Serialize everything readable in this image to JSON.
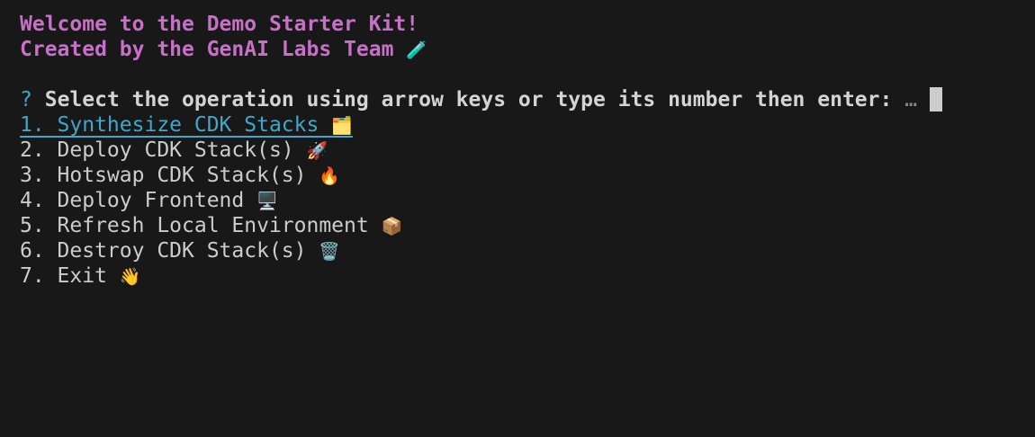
{
  "header": {
    "welcome": "Welcome to the Demo Starter Kit!",
    "created_by": "Created by the GenAI Labs Team",
    "created_by_emoji": "🧪"
  },
  "prompt": {
    "symbol": "?",
    "text": "Select the operation using arrow keys or type its number then enter:",
    "ellipsis": "…"
  },
  "options": [
    {
      "label": "1. Synthesize CDK Stacks",
      "emoji": "🗂️",
      "selected": true
    },
    {
      "label": "2. Deploy CDK Stack(s)",
      "emoji": "🚀"
    },
    {
      "label": "3. Hotswap CDK Stack(s)",
      "emoji": "🔥"
    },
    {
      "label": "4. Deploy Frontend",
      "emoji": "🖥️"
    },
    {
      "label": "5. Refresh Local Environment",
      "emoji": "📦"
    },
    {
      "label": "6. Destroy CDK Stack(s)",
      "emoji": "🗑️"
    },
    {
      "label": "7. Exit",
      "emoji": "👋"
    }
  ],
  "colors": {
    "background": "#181818",
    "accent": "#3fa7c9",
    "welcome": "#c86fc9"
  }
}
